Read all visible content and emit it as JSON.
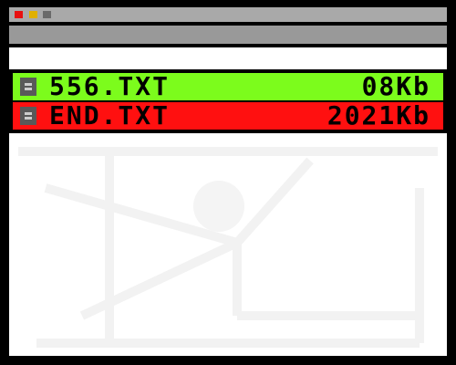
{
  "window": {
    "buttons": [
      {
        "name": "close",
        "color": "#e81010"
      },
      {
        "name": "minimize",
        "color": "#e0b000"
      },
      {
        "name": "maximize",
        "color": "#6a6a6a"
      }
    ]
  },
  "files": [
    {
      "name": "556.TXT",
      "size": "08Kb",
      "row_color": "#7cfc1c",
      "icon": "document-icon"
    },
    {
      "name": "END.TXT",
      "size": "2021Kb",
      "row_color": "#ff1010",
      "icon": "document-icon"
    }
  ],
  "colors": {
    "frame": "#000000",
    "title_bar": "#a9a9a9",
    "toolbar": "#999999",
    "content_bg": "#ffffff"
  }
}
